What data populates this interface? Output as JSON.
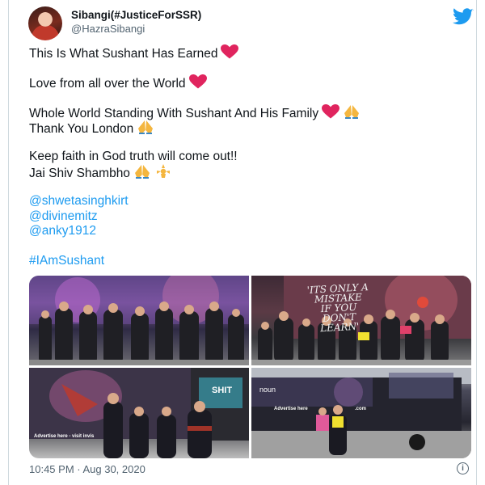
{
  "tweet": {
    "display_name": "Sibangi(#JusticeForSSR)",
    "handle": "@HazraSibangi",
    "lines": {
      "l1": "This Is What Sushant Has Earned",
      "l2": "Love from all over the World",
      "l3": "Whole World Standing With Sushant And His Family",
      "l4": "Thank You London",
      "l5": "Keep faith in God truth will come out!!",
      "l6": "Jai Shiv Shambho"
    },
    "mentions": [
      "@shwetasinghkirt",
      "@divinemitz",
      "@anky1912"
    ],
    "hashtag": "#IAmSushant",
    "timestamp": "10:45 PM · Aug 30, 2020",
    "info_glyph": "i"
  },
  "media": {
    "photo2_screen_text": [
      "'ITS ONLY A",
      "MISTAKE",
      "IF YOU DON'T",
      "LEARN'"
    ],
    "photo3_ad_text": "Advertise here - visit invis",
    "photo3_side_text": "SHIT",
    "photo4_screen_text": "noun",
    "photo4_ad_text": "Advertise here",
    "photo4_ad_suffix": ".com"
  },
  "icons": {
    "brand": "twitter-bird-icon",
    "heart": "red-heart-icon",
    "hands": "folded-hands-icon",
    "om": "om-symbol-icon"
  },
  "colors": {
    "link": "#1d9bf0",
    "secondary_text": "#536471",
    "heart": "#e0245e"
  }
}
